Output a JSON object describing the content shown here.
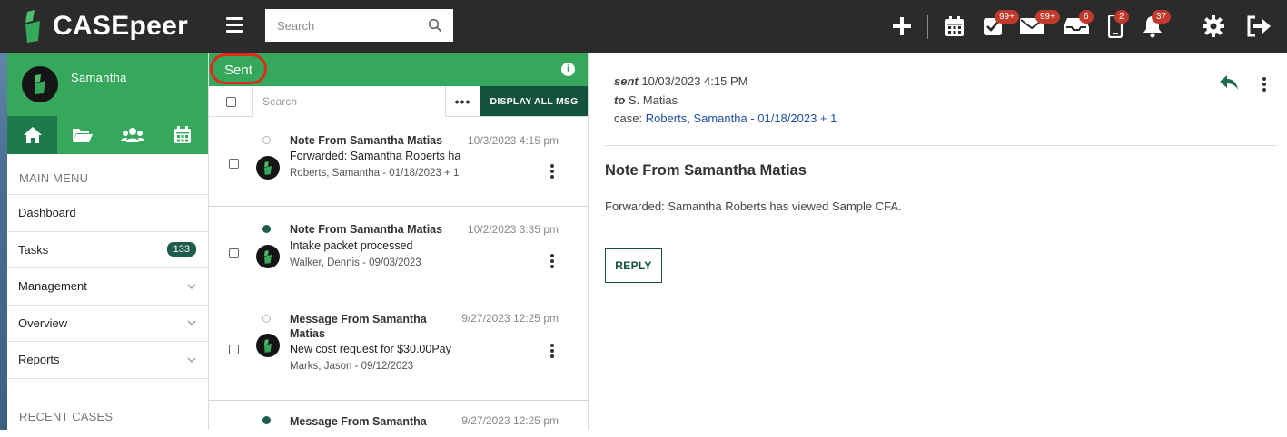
{
  "app": {
    "brand": "CASEpeer",
    "search_placeholder": "Search",
    "badges": {
      "tasks": "99+",
      "mail": "99+",
      "inbox": "6",
      "phone": "2",
      "notifications": "37"
    },
    "colors": {
      "topbar": "#2b2b2b",
      "brand_green": "#35a85b",
      "dark_green": "#15513f",
      "badge_red": "#c0392b"
    }
  },
  "sidebar": {
    "user_name": "Samantha",
    "main_menu_label": "MAIN MENU",
    "items": [
      {
        "label": "Dashboard"
      },
      {
        "label": "Tasks",
        "count": "133"
      },
      {
        "label": "Management"
      },
      {
        "label": "Overview"
      },
      {
        "label": "Reports"
      }
    ],
    "recent_cases_label": "RECENT CASES"
  },
  "list": {
    "title": "Sent",
    "info": "i",
    "search_placeholder": "Search",
    "more_label": "•••",
    "display_all_label": "DISPLAY ALL MSG",
    "messages": [
      {
        "title": "Note From Samantha Matias",
        "date": "10/3/2023 4:15 pm",
        "body": "Forwarded: Samantha Roberts ha",
        "case": "Roberts, Samantha - 01/18/2023 + 1",
        "read": true
      },
      {
        "title": "Note From Samantha Matias",
        "date": "10/2/2023 3:35 pm",
        "body": "Intake packet processed",
        "case": "Walker, Dennis - 09/03/2023",
        "read": false
      },
      {
        "title": "Message From Samantha Matias",
        "date": "9/27/2023 12:25 pm",
        "body": "New cost request for $30.00Pay",
        "case": "Marks, Jason - 09/12/2023",
        "read": true
      },
      {
        "title": "Message From Samantha",
        "date": "9/27/2023 12:25 pm",
        "read": false
      }
    ]
  },
  "detail": {
    "sent_label": "sent",
    "sent_date": "10/03/2023 4:15 PM",
    "to_label": "to",
    "to_name": "S. Matias",
    "case_label": "case:",
    "case_link": "Roberts, Samantha - 01/18/2023 + 1",
    "title": "Note From Samantha Matias",
    "body": "Forwarded: Samantha Roberts has viewed Sample CFA.",
    "reply_label": "REPLY"
  }
}
